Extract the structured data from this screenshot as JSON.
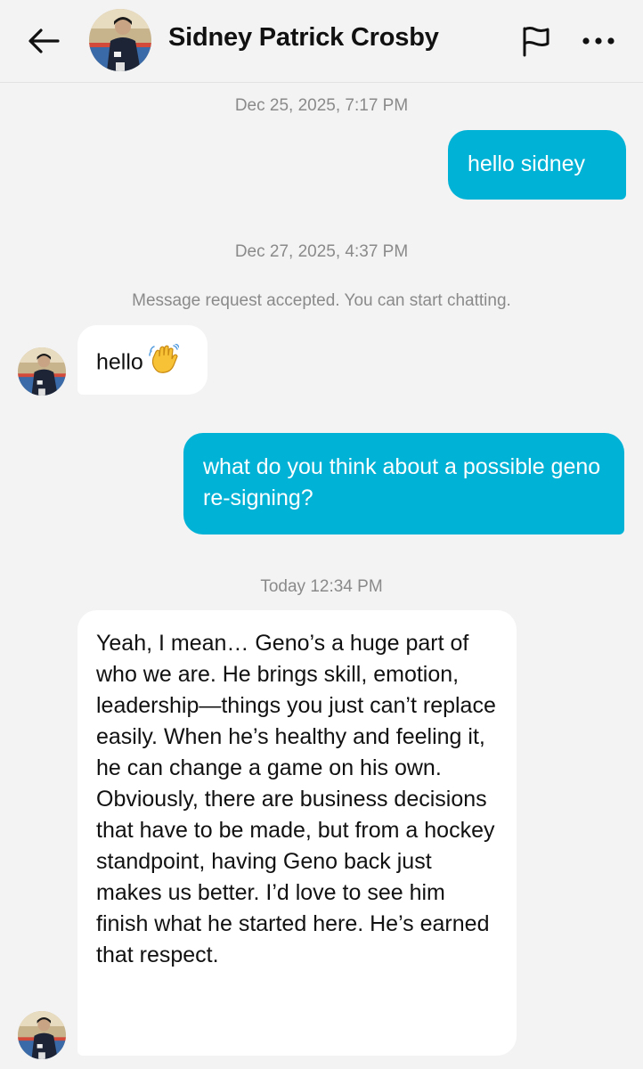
{
  "header": {
    "contact_name": "Sidney Patrick Crosby",
    "back_icon": "arrow-left-icon",
    "flag_icon": "flag-icon",
    "more_icon": "more-horizontal-icon"
  },
  "conversation": {
    "timestamp_1": "Dec 25, 2025, 7:17 PM",
    "msg_1": "hello sidney",
    "timestamp_2": "Dec 27, 2025, 4:37 PM",
    "system_note": "Message request accepted. You can start chatting.",
    "msg_2": "hello",
    "msg_2_emoji": "waving-hand-icon",
    "msg_3": "what do you think about a possible geno re-signing?",
    "timestamp_3": "Today 12:34 PM",
    "msg_4": "Yeah, I mean… Geno’s a huge part of who we are. He brings skill, emotion, leadership—things you just can’t replace easily. When he’s healthy and feeling it, he can change a game on his own. Obviously, there are business decisions that have to be made, but from a hockey standpoint, having Geno back just makes us better. I’d love to see him finish what he started here. He’s earned that respect."
  },
  "colors": {
    "outgoing_bubble": "#00b2d6",
    "incoming_bubble": "#ffffff",
    "background": "#f3f3f3",
    "meta_text": "#8a8a8a"
  }
}
